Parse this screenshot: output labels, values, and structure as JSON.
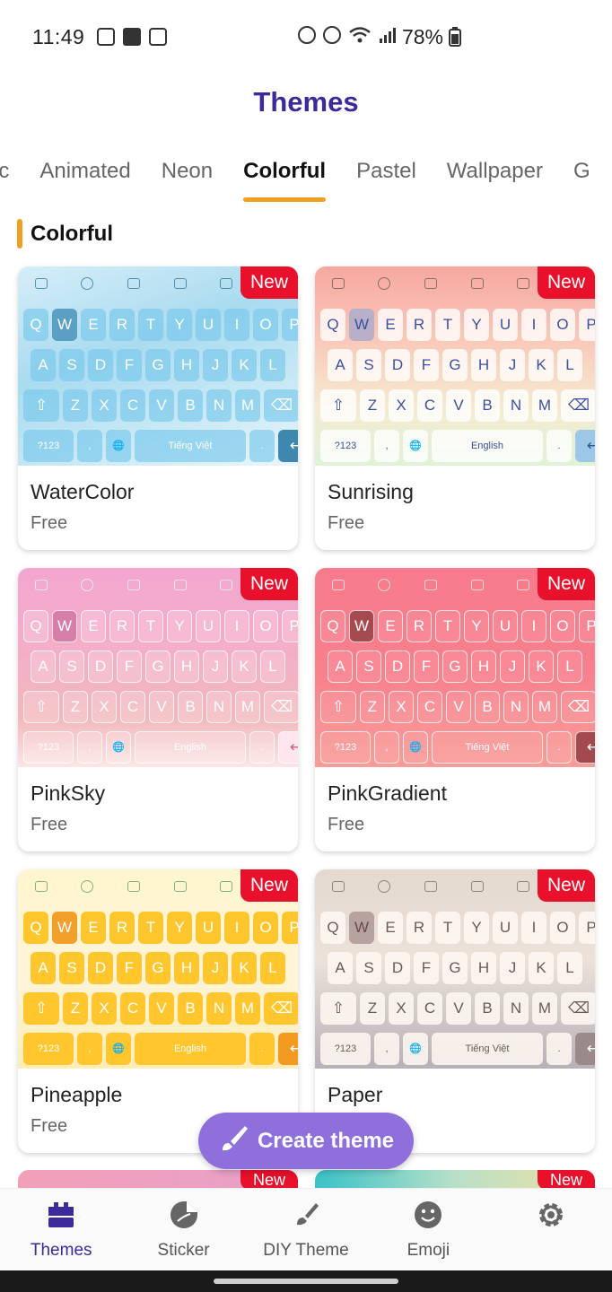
{
  "status_bar": {
    "time": "11:49",
    "battery": "78%"
  },
  "page": {
    "title": "Themes"
  },
  "tabs": [
    {
      "label": "Basic",
      "visible": "sic"
    },
    {
      "label": "Animated"
    },
    {
      "label": "Neon"
    },
    {
      "label": "Colorful"
    },
    {
      "label": "Pastel"
    },
    {
      "label": "Wallpaper"
    },
    {
      "label": "G"
    }
  ],
  "active_tab": "Colorful",
  "section": {
    "title": "Colorful"
  },
  "badge_label": "New",
  "keyboard": {
    "row1": [
      "Q",
      "W",
      "E",
      "R",
      "T",
      "Y",
      "U",
      "I",
      "O",
      "P"
    ],
    "row2": [
      "A",
      "S",
      "D",
      "F",
      "G",
      "H",
      "J",
      "K",
      "L"
    ],
    "row3": [
      "Z",
      "X",
      "C",
      "V",
      "B",
      "N",
      "M"
    ],
    "num_key": "?123",
    "comma": ",",
    "dot": ".",
    "space_vi": "Tiếng Việt",
    "space_en": "English"
  },
  "themes": [
    {
      "name": "WaterColor",
      "price": "Free"
    },
    {
      "name": "Sunrising",
      "price": "Free"
    },
    {
      "name": "PinkSky",
      "price": "Free"
    },
    {
      "name": "PinkGradient",
      "price": "Free"
    },
    {
      "name": "Pineapple",
      "price": "Free"
    },
    {
      "name": "Paper",
      "price": ""
    }
  ],
  "fab": {
    "label": "Create theme",
    "icon": "paintbrush-icon"
  },
  "bottom_nav": [
    {
      "label": "Themes",
      "icon": "themes-icon",
      "active": true
    },
    {
      "label": "Sticker",
      "icon": "sticker-icon"
    },
    {
      "label": "DIY Theme",
      "icon": "brush-icon"
    },
    {
      "label": "Emoji",
      "icon": "smiley-icon"
    },
    {
      "label": "",
      "icon": "gear-icon"
    }
  ],
  "colors": {
    "accent": "#3a2a9a",
    "tab_indicator": "#f0a020",
    "badge": "#e8102a",
    "fab": "#8e6fdc"
  }
}
